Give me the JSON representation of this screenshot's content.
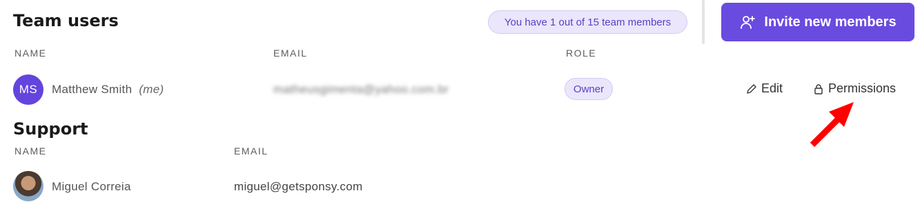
{
  "team": {
    "title": "Team users",
    "member_count_text": "You have 1 out of 15 team members",
    "invite_label": "Invite new members",
    "columns": {
      "name": "NAME",
      "email": "EMAIL",
      "role": "ROLE"
    },
    "user": {
      "initials": "MS",
      "name": "Matthew Smith",
      "me_label": "(me)",
      "email": "matheusgimenta@yahoo.com.br",
      "role": "Owner",
      "edit_label": "Edit",
      "permissions_label": "Permissions"
    }
  },
  "support": {
    "title": "Support",
    "columns": {
      "name": "NAME",
      "email": "EMAIL"
    },
    "user": {
      "name": "Miguel Correia",
      "email": "miguel@getsponsy.com"
    }
  },
  "colors": {
    "accent": "#6a4be0",
    "badge_bg": "#ebe6fb",
    "annotation_arrow": "#ff0000"
  }
}
